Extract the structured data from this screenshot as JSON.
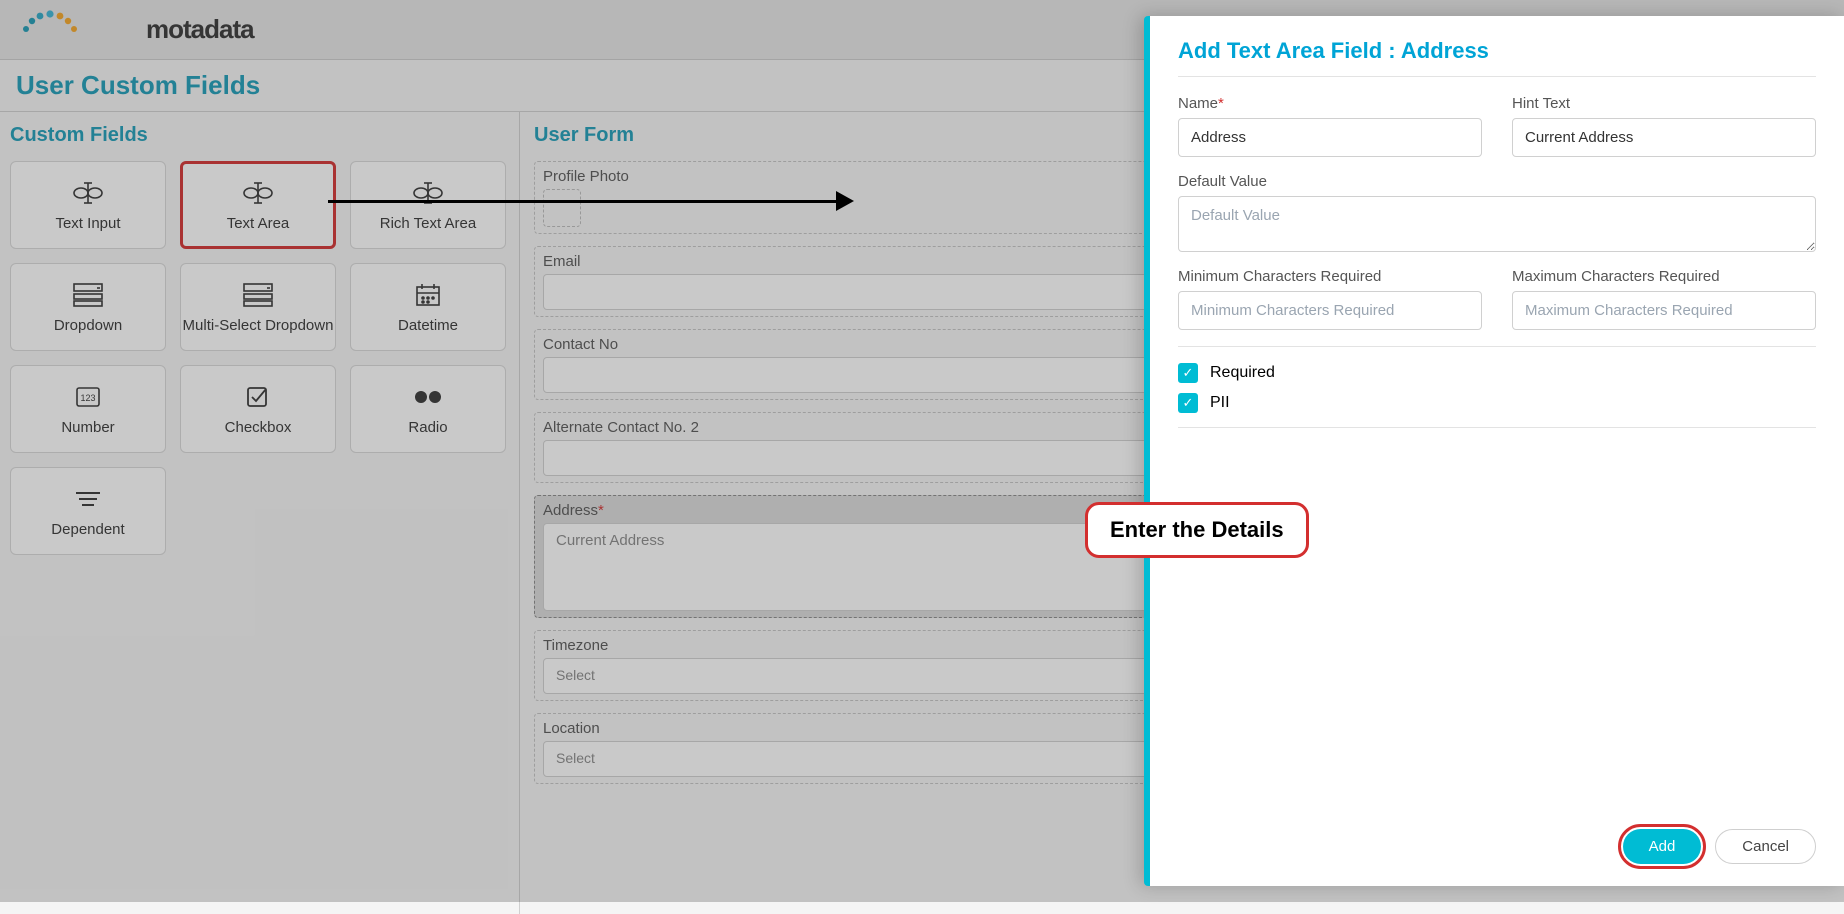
{
  "logo_text": "motadata",
  "page_title": "User Custom Fields",
  "left": {
    "title": "Custom Fields",
    "items": [
      "Text Input",
      "Text Area",
      "Rich Text Area",
      "Dropdown",
      "Multi-Select Dropdown",
      "Datetime",
      "Number",
      "Checkbox",
      "Radio",
      "Dependent"
    ]
  },
  "form": {
    "title": "User Form",
    "profile": "Profile Photo",
    "email": "Email",
    "contact": "Contact No",
    "alt_contact": "Alternate Contact No. 2",
    "address_label": "Address",
    "address_placeholder": "Current Address",
    "timezone": "Timezone",
    "location": "Location",
    "select": "Select"
  },
  "drawer": {
    "title": "Add Text Area Field : Address",
    "name_label": "Name",
    "name_value": "Address",
    "hint_label": "Hint Text",
    "hint_value": "Current Address",
    "default_label": "Default Value",
    "default_placeholder": "Default Value",
    "min_label": "Minimum Characters Required",
    "min_placeholder": "Minimum Characters Required",
    "max_label": "Maximum Characters Required",
    "max_placeholder": "Maximum Characters Required",
    "required_label": "Required",
    "pii_label": "PII",
    "add_btn": "Add",
    "cancel_btn": "Cancel"
  },
  "annotation": "Enter the Details"
}
